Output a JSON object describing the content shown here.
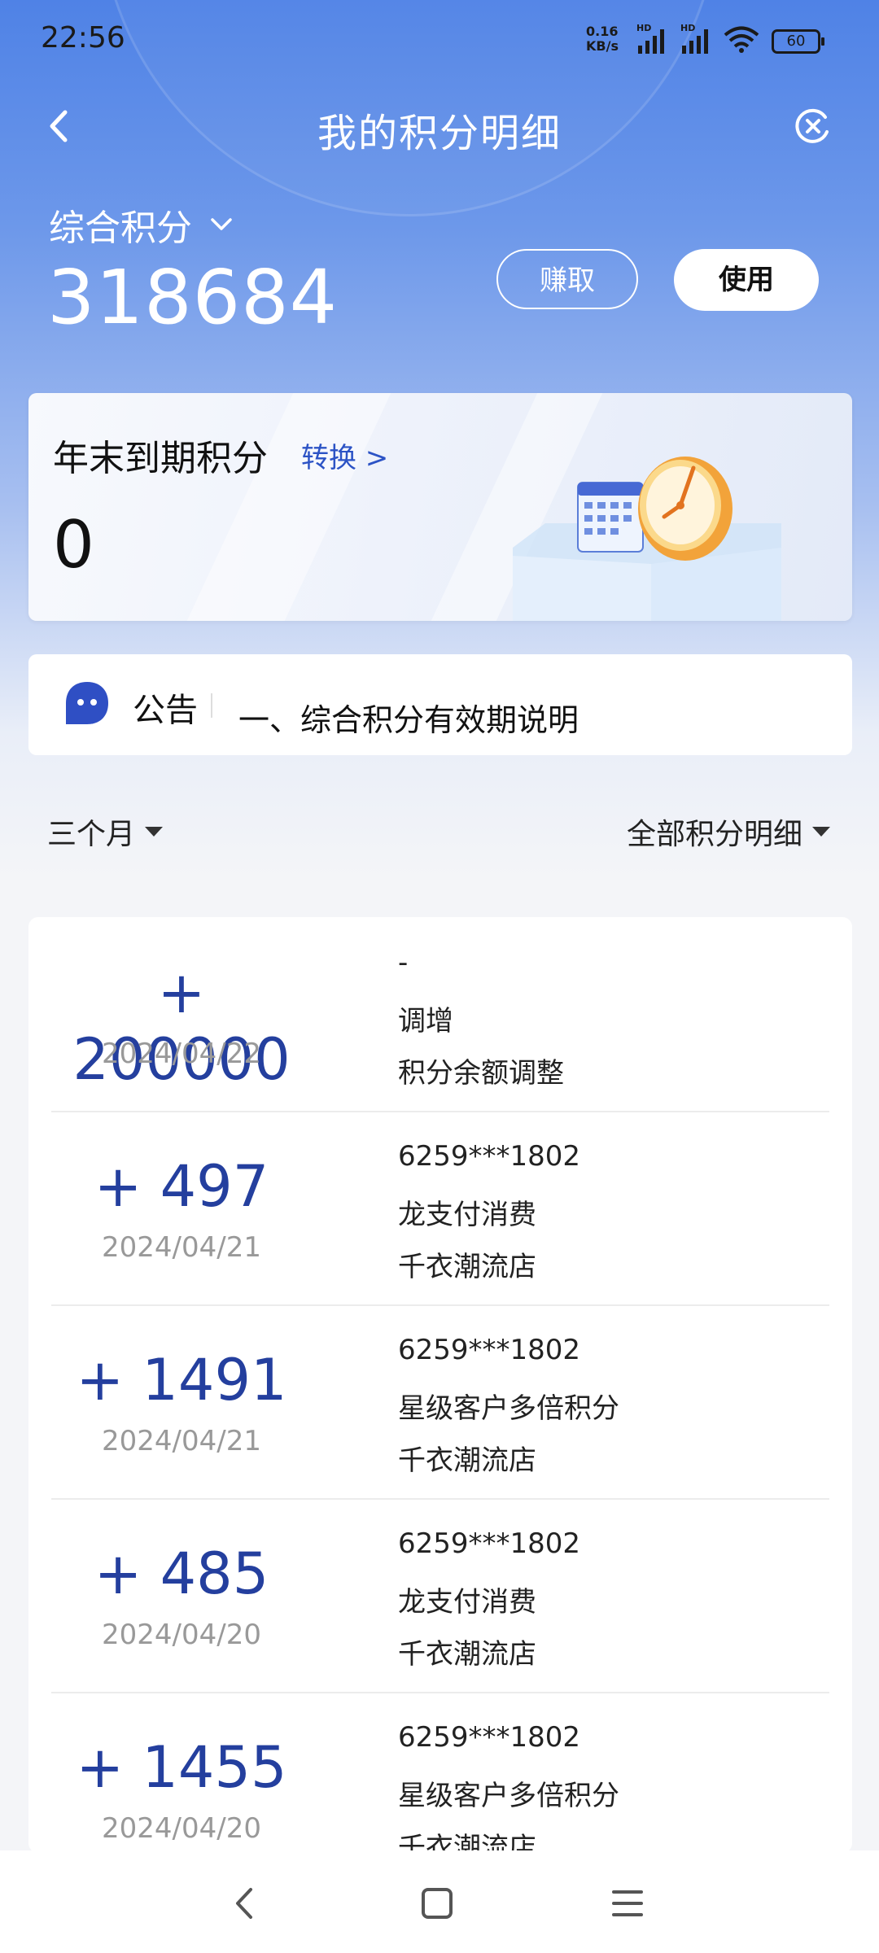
{
  "status_bar": {
    "time": "22:56",
    "net_speed_value": "0.16",
    "net_speed_unit": "KB/s",
    "battery": "60"
  },
  "header": {
    "title": "我的积分明细"
  },
  "points": {
    "label": "综合积分",
    "value": "318684",
    "earn_label": "赚取",
    "use_label": "使用"
  },
  "expire": {
    "title": "年末到期积分",
    "link": "转换 >",
    "value": "0"
  },
  "notice": {
    "label": "公告",
    "text": "一、综合积分有效期说明"
  },
  "filters": {
    "period": "三个月",
    "type": "全部积分明细"
  },
  "transactions": [
    {
      "amount": "+ 200000",
      "date": "2024/04/22",
      "line1": "-",
      "line2": "调增",
      "line3": "积分余额调整"
    },
    {
      "amount": "+ 497",
      "date": "2024/04/21",
      "line1": "6259***1802",
      "line2": "龙支付消费",
      "line3": "千衣潮流店"
    },
    {
      "amount": "+ 1491",
      "date": "2024/04/21",
      "line1": "6259***1802",
      "line2": "星级客户多倍积分",
      "line3": "千衣潮流店"
    },
    {
      "amount": "+ 485",
      "date": "2024/04/20",
      "line1": "6259***1802",
      "line2": "龙支付消费",
      "line3": "千衣潮流店"
    },
    {
      "amount": "+ 1455",
      "date": "2024/04/20",
      "line1": "6259***1802",
      "line2": "星级客户多倍积分",
      "line3": "千衣潮流店"
    }
  ],
  "icons": {
    "back": "back-arrow-icon",
    "close": "close-circle-icon",
    "dropdown": "chevron-down-icon",
    "notice": "chat-bubble-icon",
    "illustration": "calendar-clock-illustration"
  },
  "colors": {
    "header_blue": "#4f82e6",
    "amount_blue": "#243f9e",
    "link_blue": "#2c53c5"
  }
}
